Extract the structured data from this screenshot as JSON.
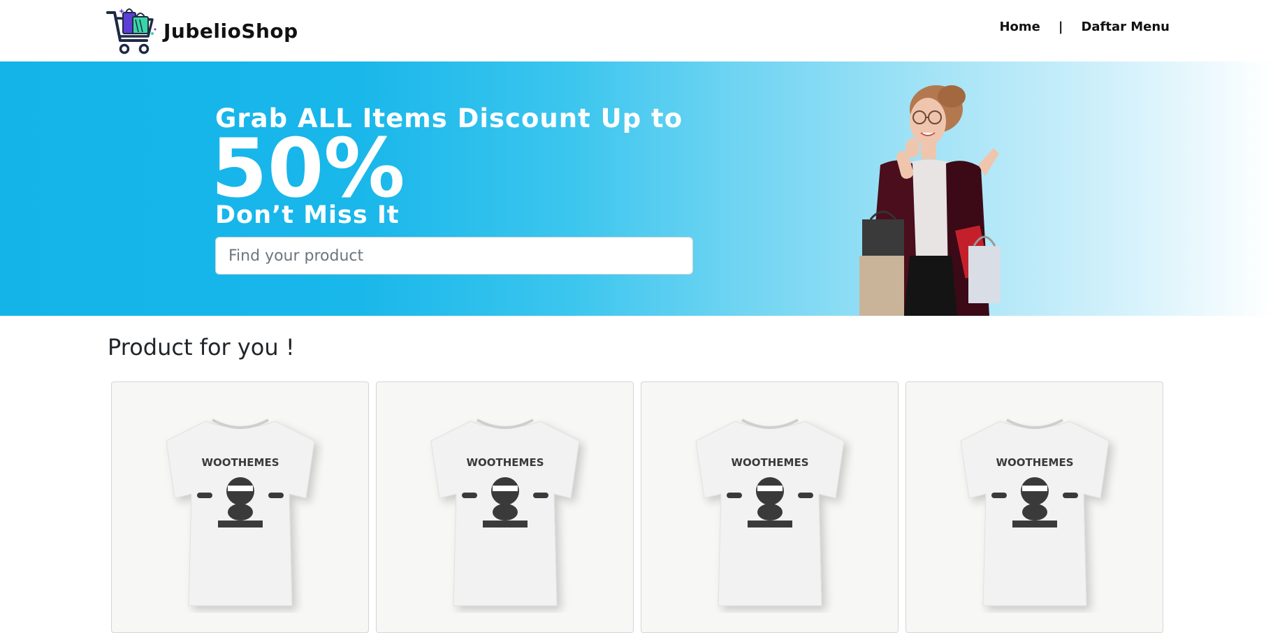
{
  "brand": {
    "name": "JubelioShop",
    "logo_icon": "shopping-cart-with-bags-icon"
  },
  "nav": {
    "links": [
      {
        "label": "Home"
      },
      {
        "label": "Daftar Menu"
      }
    ],
    "separator": "|"
  },
  "hero": {
    "headline": "Grab ALL Items Discount Up to",
    "discount": "50%",
    "tagline": "Don’t Miss It",
    "search": {
      "placeholder": "Find your product",
      "value": ""
    },
    "image": "woman-holding-shopping-bags"
  },
  "products": {
    "title": "Product for you !",
    "items": [
      {
        "image": "white-tshirt-woothemes"
      },
      {
        "image": "white-tshirt-woothemes"
      },
      {
        "image": "white-tshirt-woothemes"
      },
      {
        "image": "white-tshirt-woothemes"
      }
    ],
    "shirt_print_text": "WOOTHEMES"
  },
  "colors": {
    "hero_blue": "#14b4e9",
    "hero_fade": "#ffffff",
    "text_dark": "#212529"
  }
}
